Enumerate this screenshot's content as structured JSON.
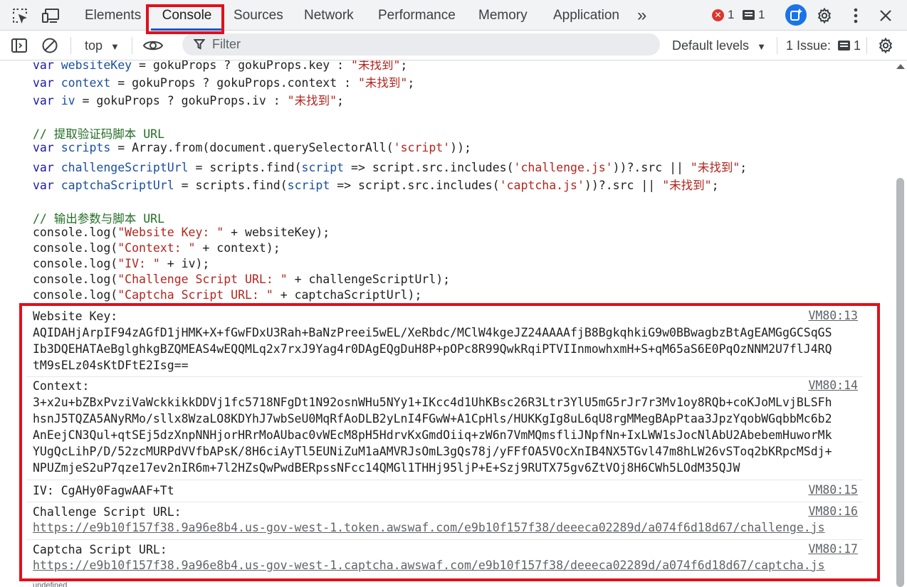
{
  "tabs": {
    "elements": "Elements",
    "console": "Console",
    "sources": "Sources",
    "network": "Network",
    "performance": "Performance",
    "memory": "Memory",
    "application": "Application",
    "more": "»"
  },
  "badges": {
    "errors": "1",
    "messages": "1"
  },
  "toolbar": {
    "context": "top",
    "filter_placeholder": "Filter",
    "levels": "Default levels",
    "issues_label": "1 Issue:",
    "issues_count": "1"
  },
  "code": {
    "l1_a": "var ",
    "l1_b": "websiteKey",
    "l1_c": " = gokuProps ? gokuProps.key : ",
    "l1_d": "\"未找到\"",
    "l1_e": ";",
    "l2_a": "var ",
    "l2_b": "context",
    "l2_c": " = gokuProps ? gokuProps.context : ",
    "l2_d": "\"未找到\"",
    "l2_e": ";",
    "l3_a": "var ",
    "l3_b": "iv",
    "l3_c": " = gokuProps ? gokuProps.iv : ",
    "l3_d": "\"未找到\"",
    "l3_e": ";",
    "c1": "// 提取验证码脚本 URL",
    "l4_a": "var ",
    "l4_b": "scripts",
    "l4_c": " = Array.from(document.querySelectorAll(",
    "l4_d": "'script'",
    "l4_e": "));",
    "l5_a": "var ",
    "l5_b": "challengeScriptUrl",
    "l5_c": " = scripts.find(",
    "l5_d": "script",
    "l5_e": " => script.src.includes(",
    "l5_f": "'challenge.js'",
    "l5_g": "))?.src || ",
    "l5_h": "\"未找到\"",
    "l5_i": ";",
    "l6_a": "var ",
    "l6_b": "captchaScriptUrl",
    "l6_c": " = scripts.find(",
    "l6_d": "script",
    "l6_e": " => script.src.includes(",
    "l6_f": "'captcha.js'",
    "l6_g": "))?.src || ",
    "l6_h": "\"未找到\"",
    "l6_i": ";",
    "c2": "// 输出参数与脚本 URL",
    "l7_a": "console.log(",
    "l7_b": "\"Website Key: \"",
    "l7_c": " + websiteKey);",
    "l8_a": "console.log(",
    "l8_b": "\"Context: \"",
    "l8_c": " + context);",
    "l9_a": "console.log(",
    "l9_b": "\"IV: \"",
    "l9_c": " + iv);",
    "l10_a": "console.log(",
    "l10_b": "\"Challenge Script URL: \"",
    "l10_c": " + challengeScriptUrl);",
    "l11_a": "console.log(",
    "l11_b": "\"Captcha Script URL: \"",
    "l11_c": " + captchaScriptUrl);"
  },
  "output": {
    "m1": {
      "text": "Website Key:\nAQIDAHjArpIF94zAGfD1jHMK+X+fGwFDxU3Rah+BaNzPreei5wEL/XeRbdc/MClW4kgeJZ24AAAAfjB8BgkqhkiG9w0BBwagbzBtAgEAMGgGCSqGS\nIb3DQEHATAeBglghkgBZQMEAS4wEQQMLq2x7rxJ9Yag4r0DAgEQgDuH8P+pOPc8R99QwkRqiPTVIInmowhxmH+S+qM65aS6E0PqOzNNM2U7flJ4RQ\ntM9sELz04sKtDFtE2Isg==",
      "source": "VM80:13"
    },
    "m2": {
      "text": "Context:\n3+x2u+bZBxPvziVaWckkikkDDVj1fc5718NFgDt1N92osnWHu5NYy1+IKcc4d1UhKBsc26R3Ltr3YlU5mG5rJr7r3Mv1oy8RQb+coKJoMLvjBLSFh\nhsnJ5TQZA5ANyRMo/sllx8WzaLO8KDYhJ7wbSeU0MqRfAoDLB2yLnI4FGwW+A1CpHls/HUKKgIg8uL6qU8rgMMegBApPtaa3JpzYqobWGqbbMc6b2\nAnEejCN3Qul+qtSEj5dzXnpNNHjorHRrMoAUbac0vWEcM8pH5HdrvKxGmdOiiq+zW6n7VmMQmsfliJNpfNn+IxLWW1sJocNlAbU2AbebemHuworMk\nYUgQcLihP/D/52zcMURPdVVfbAPsK/8H6ciAyTl5EUNiZuM1aAMVRJsOmL3gQs78j/yFFfOA5VOcXnIB4NX5TGvl47m8hLW26vSToq2bKRpcMSdj+\nNPUZmjeS2uP7qze17ev2nIR6m+7l2HZsQwPwdBERpssNFcc14QMGl1THHj95ljP+E+Szj9RUTX75gv6ZtVOj8H6CWh5LOdM35QJW",
      "source": "VM80:14"
    },
    "m3": {
      "text": "IV: CgAHy0FagwAAF+Tt",
      "source": "VM80:15"
    },
    "m4": {
      "label": "Challenge Script URL:",
      "url": "https://e9b10f157f38.9a96e8b4.us-gov-west-1.token.awswaf.com/e9b10f157f38/deeeca02289d/a074f6d18d67/challenge.js",
      "source": "VM80:16"
    },
    "m5": {
      "label": "Captcha Script URL:",
      "url": "https://e9b10f157f38.9a96e8b4.us-gov-west-1.captcha.awswaf.com/e9b10f157f38/deeeca02289d/a074f6d18d67/captcha.js",
      "source": "VM80:17"
    }
  },
  "partial_line": "undefined"
}
